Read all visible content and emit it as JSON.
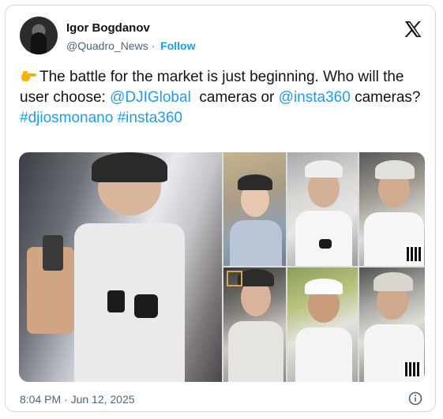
{
  "author": {
    "name": "Igor Bogdanov",
    "handle": "@Quadro_News",
    "separator": "·",
    "follow_label": "Follow"
  },
  "icons": {
    "logo": "x-logo-icon",
    "pointing": "backhand-index-pointing-right-emoji",
    "info": "info-icon"
  },
  "tweet": {
    "part1": "The battle for the market is just beginning. Who will the user choose: ",
    "mention1": "@DJIGlobal",
    "part2": "  cameras or ",
    "mention2": "@insta360",
    "part3": " cameras?",
    "hashtag1": "#djiosmonano",
    "hashtag2": "#insta360"
  },
  "timestamp": "8:04 PM · Jun 12, 2025",
  "colors": {
    "link": "#1d9bf0",
    "text": "#0f1419",
    "muted": "#536471",
    "border": "#cfd9de"
  }
}
